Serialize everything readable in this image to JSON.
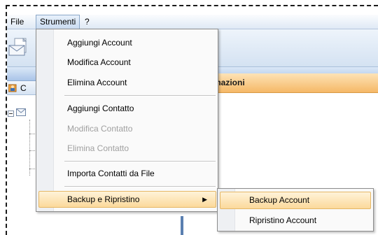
{
  "menubar": {
    "items": [
      {
        "label": "File"
      },
      {
        "label": "Strumenti"
      },
      {
        "label": "?"
      }
    ]
  },
  "left_panel": {
    "header_letter": "C"
  },
  "info_panel": {
    "header": "mazioni"
  },
  "dropdown": {
    "items": [
      {
        "label": "Aggiungi Account",
        "enabled": true
      },
      {
        "label": "Modifica Account",
        "enabled": true
      },
      {
        "label": "Elimina Account",
        "enabled": true
      },
      {
        "label": "Aggiungi Contatto",
        "enabled": true
      },
      {
        "label": "Modifica Contatto",
        "enabled": false
      },
      {
        "label": "Elimina Contatto",
        "enabled": false
      },
      {
        "label": "Importa Contatti da File",
        "enabled": true
      },
      {
        "label": "Backup e Ripristino",
        "enabled": true,
        "has_submenu": true,
        "highlighted": true
      }
    ]
  },
  "submenu": {
    "items": [
      {
        "label": "Backup Account",
        "highlighted": true
      },
      {
        "label": "Ripristino Account"
      }
    ]
  },
  "colors": {
    "menu_highlight": "#fbd99b",
    "info_header": "#f5b867",
    "toolbar": "#d4e2f2",
    "disabled_text": "#a0a0a0"
  },
  "icons": {
    "toolbar": "envelope-icon",
    "panel": "contacts-icon",
    "tree": "envelope-icon",
    "submenu_indicator": "triangle-right-icon"
  }
}
